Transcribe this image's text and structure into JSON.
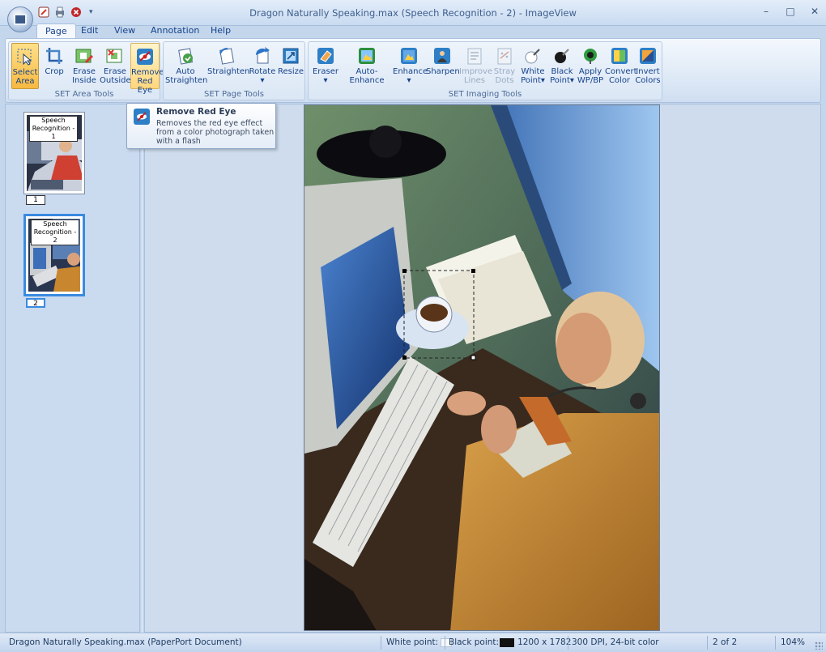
{
  "window": {
    "title": "Dragon Naturally Speaking.max (Speech Recognition - 2) - ImageView",
    "controls": {
      "minimize": "–",
      "maximize": "□",
      "close": "✕"
    }
  },
  "quick_access": {
    "items": [
      {
        "name": "edit-icon",
        "color": "#d7342a"
      },
      {
        "name": "print-icon",
        "color": "#6a7b92"
      },
      {
        "name": "stop-icon",
        "color": "#c0262b"
      }
    ],
    "dropdown": "▾"
  },
  "tabs": [
    {
      "label": "Page",
      "active": true
    },
    {
      "label": "Edit",
      "active": false
    },
    {
      "label": "View",
      "active": false
    },
    {
      "label": "Annotation",
      "active": false
    },
    {
      "label": "Help",
      "active": false
    }
  ],
  "ribbon": {
    "groups": [
      {
        "label": "SET Area Tools",
        "buttons": [
          {
            "label1": "Select",
            "label2": "Area",
            "icon": "select-area-icon",
            "state": "selected"
          },
          {
            "label1": "Crop",
            "label2": "",
            "icon": "crop-icon",
            "state": "normal"
          },
          {
            "label1": "Erase",
            "label2": "Inside",
            "icon": "erase-inside-icon",
            "state": "normal"
          },
          {
            "label1": "Erase",
            "label2": "Outside",
            "icon": "erase-outside-icon",
            "state": "normal"
          },
          {
            "label1": "Remove",
            "label2": "Red Eye",
            "icon": "remove-red-eye-icon",
            "state": "hover"
          }
        ]
      },
      {
        "label": "SET Page Tools",
        "buttons": [
          {
            "label1": "Auto",
            "label2": "Straighten",
            "icon": "auto-straighten-icon",
            "state": "normal"
          },
          {
            "label1": "Straighten",
            "label2": "",
            "icon": "straighten-icon",
            "state": "normal"
          },
          {
            "label1": "Rotate",
            "label2": "▾",
            "icon": "rotate-icon",
            "state": "normal"
          },
          {
            "label1": "Resize",
            "label2": "",
            "icon": "resize-icon",
            "state": "normal"
          }
        ]
      },
      {
        "label": "SET Imaging Tools",
        "buttons": [
          {
            "label1": "Eraser",
            "label2": "▾",
            "icon": "eraser-icon",
            "state": "normal"
          },
          {
            "label1": "Auto-Enhance",
            "label2": "",
            "icon": "auto-enhance-icon",
            "state": "normal"
          },
          {
            "label1": "Enhance",
            "label2": "▾",
            "icon": "enhance-icon",
            "state": "normal"
          },
          {
            "label1": "Sharpen",
            "label2": "",
            "icon": "sharpen-icon",
            "state": "normal"
          },
          {
            "label1": "Improve",
            "label2": "Lines",
            "icon": "improve-lines-icon",
            "state": "disabled"
          },
          {
            "label1": "Stray",
            "label2": "Dots",
            "icon": "stray-dots-icon",
            "state": "disabled"
          },
          {
            "label1": "White",
            "label2": "Point▾",
            "icon": "white-point-icon",
            "state": "normal"
          },
          {
            "label1": "Black",
            "label2": "Point▾",
            "icon": "black-point-icon",
            "state": "normal"
          },
          {
            "label1": "Apply",
            "label2": "WP/BP",
            "icon": "apply-wpbp-icon",
            "state": "normal"
          },
          {
            "label1": "Convert",
            "label2": "Color",
            "icon": "convert-color-icon",
            "state": "normal"
          },
          {
            "label1": "Invert",
            "label2": "Colors",
            "icon": "invert-colors-icon",
            "state": "normal"
          }
        ]
      }
    ]
  },
  "tooltip": {
    "title": "Remove Red Eye",
    "body": "Removes the red eye effect from a color photograph taken with a flash"
  },
  "thumbnails": [
    {
      "label": "Speech Recognition - 1",
      "page": "1",
      "selected": false
    },
    {
      "label": "Speech Recognition - 2",
      "page": "2",
      "selected": true
    }
  ],
  "status": {
    "document": "Dragon Naturally Speaking.max (PaperPort Document)",
    "white_point": "White point:",
    "black_point": "Black point:",
    "dimensions": "1200 x 1782",
    "dpi": "300 DPI, 24-bit color",
    "page": "2 of 2",
    "zoom": "104%"
  },
  "colors": {
    "accent": "#3a8ae0",
    "ribbon_text": "#15428b",
    "selected_button": "#f8b940"
  }
}
